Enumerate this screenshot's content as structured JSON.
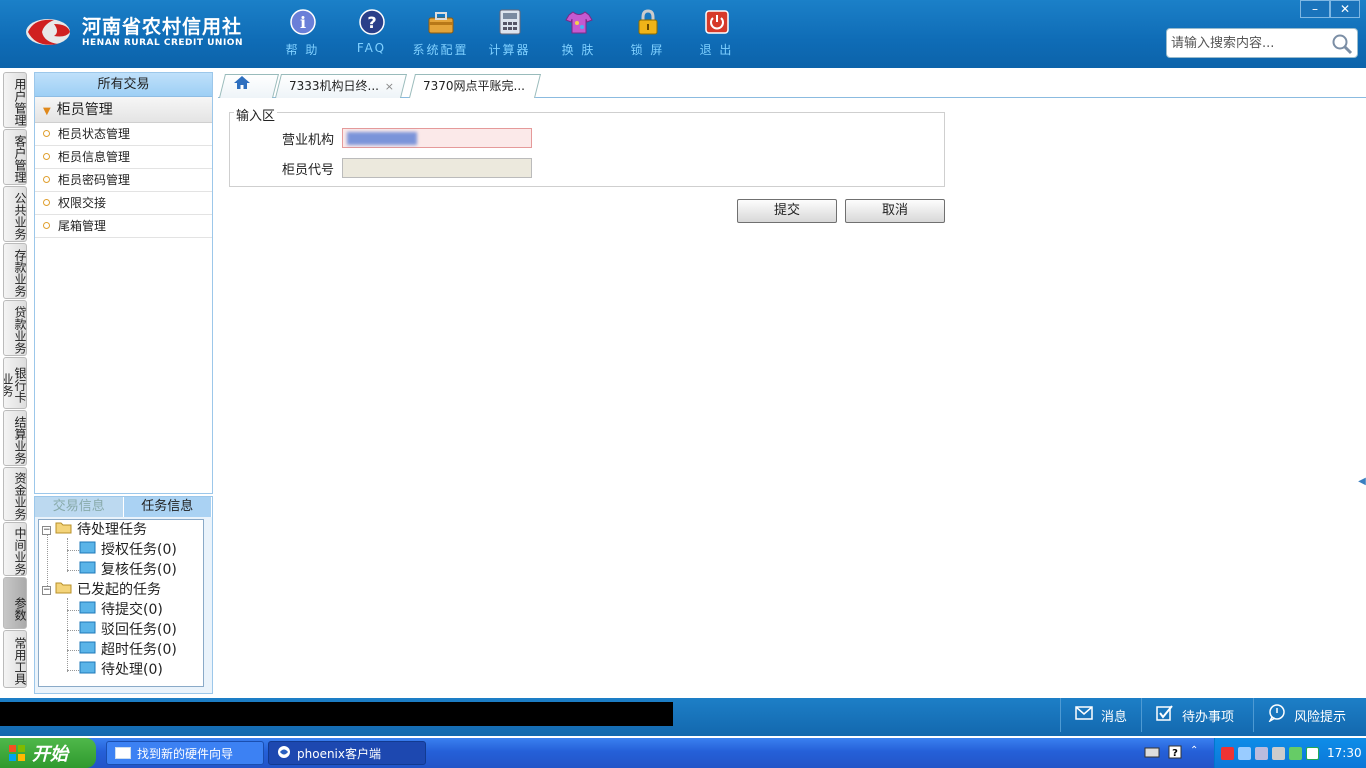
{
  "header": {
    "logo_cn": "河南省农村信用社",
    "logo_en": "HENAN RURAL CREDIT UNION",
    "toolbar": [
      {
        "label": "帮 助",
        "icon": "info-icon"
      },
      {
        "label": "FAQ",
        "icon": "question-icon"
      },
      {
        "label": "系统配置",
        "icon": "toolbox-icon"
      },
      {
        "label": "计算器",
        "icon": "calculator-icon"
      },
      {
        "label": "换 肤",
        "icon": "shirt-icon"
      },
      {
        "label": "锁 屏",
        "icon": "lock-icon"
      },
      {
        "label": "退 出",
        "icon": "power-icon"
      }
    ],
    "window_minimize": "–",
    "window_close": "✕",
    "search_placeholder": "请输入搜索内容..."
  },
  "vertical_tabs": [
    {
      "label": "用户管理"
    },
    {
      "label": "客户管理"
    },
    {
      "label": "公共业务"
    },
    {
      "label": "存款业务"
    },
    {
      "label": "贷款业务"
    },
    {
      "label": "银行卡业务"
    },
    {
      "label": "结算业务"
    },
    {
      "label": "资金业务"
    },
    {
      "label": "中间业务"
    },
    {
      "label": "参数"
    },
    {
      "label": "常用工具"
    }
  ],
  "sidebar": {
    "header": "所有交易",
    "group": "柜员管理",
    "items": [
      {
        "label": "柜员状态管理"
      },
      {
        "label": "柜员信息管理"
      },
      {
        "label": "柜员密码管理"
      },
      {
        "label": "权限交接"
      },
      {
        "label": "尾箱管理"
      }
    ]
  },
  "task_panel": {
    "tabs": [
      {
        "label": "交易信息"
      },
      {
        "label": "任务信息"
      }
    ],
    "tree": {
      "pending": {
        "label": "待处理任务",
        "children": [
          {
            "label": "授权任务(0)"
          },
          {
            "label": "复核任务(0)"
          }
        ]
      },
      "initiated": {
        "label": "已发起的任务",
        "children": [
          {
            "label": "待提交(0)"
          },
          {
            "label": "驳回任务(0)"
          },
          {
            "label": "超时任务(0)"
          },
          {
            "label": "待处理(0)"
          }
        ]
      }
    }
  },
  "content_tabs": [
    {
      "label": "7333机构日终...",
      "close": "×"
    },
    {
      "label": "7370网点平账完...",
      "close": "×"
    }
  ],
  "form": {
    "legend": "输入区",
    "fields": [
      {
        "label": "营业机构",
        "value": ""
      },
      {
        "label": "柜员代号",
        "value": ""
      }
    ],
    "submit_label": "提交",
    "cancel_label": "取消"
  },
  "statusbar": {
    "messages": "消息",
    "todo": "待办事项",
    "risk": "风险提示"
  },
  "taskbar": {
    "start": "开始",
    "items": [
      {
        "label": "找到新的硬件向导"
      },
      {
        "label": "phoenix客户端"
      }
    ],
    "clock": "17:30"
  },
  "colors": {
    "header_blue": "#0f6cb6",
    "toolbar_label": "#7fd0ff",
    "sidebar_border": "#9cc7ea",
    "xp_taskbar": "#2560d8",
    "xp_start_green": "#2f9a2e"
  }
}
